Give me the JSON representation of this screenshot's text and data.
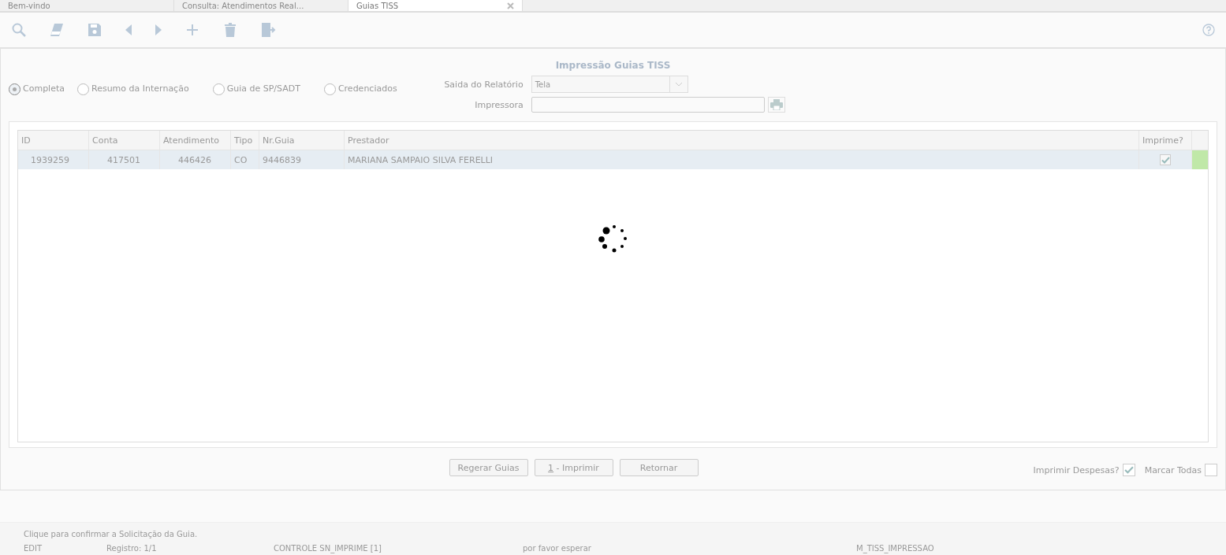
{
  "tabs": [
    {
      "label": "Bem-vindo",
      "selected": false,
      "closable": false
    },
    {
      "label": "Consulta: Atendimentos Real...",
      "selected": false,
      "closable": false
    },
    {
      "label": "Guias TISS",
      "selected": true,
      "closable": true
    }
  ],
  "toolbar": [
    {
      "kind": "search"
    },
    {
      "kind": "eraser"
    },
    {
      "kind": "save"
    },
    {
      "kind": "prev"
    },
    {
      "kind": "next"
    },
    {
      "kind": "add"
    },
    {
      "kind": "delete"
    },
    {
      "kind": "exit"
    }
  ],
  "title": "Impressão Guias TISS",
  "report_types": [
    {
      "label": "Completa",
      "selected": true
    },
    {
      "label": "Resumo da Internação",
      "selected": false
    },
    {
      "label": "Guia de SP/SADT",
      "selected": false
    },
    {
      "label": "Credenciados",
      "selected": false
    }
  ],
  "output": {
    "label": "Saida do Relatório",
    "value": "Tela"
  },
  "printer": {
    "label": "Impressora"
  },
  "table": {
    "columns": [
      "ID",
      "Conta",
      "Atendimento",
      "Tipo",
      "Nr.Guia",
      "Prestador",
      "Imprime?"
    ],
    "rows": [
      {
        "id": "1939259",
        "conta": "417501",
        "atendimento": "446426",
        "tipo": "CO",
        "nr_guia": "9446839",
        "prestador": "MARIANA SAMPAIO SILVA FERELLI",
        "imprime": true,
        "selected": true,
        "color": "#c0e8a8"
      }
    ]
  },
  "loading": true,
  "buttons": [
    {
      "label": "Regerar Guias"
    },
    {
      "shortcut": "1",
      "label": " - Imprimir"
    },
    {
      "label": "Retornar"
    }
  ],
  "options": [
    {
      "label": "Imprimir Despesas?",
      "checked": true
    },
    {
      "label": "Marcar Todas",
      "checked": false
    }
  ],
  "hint": "Clique para confirmar a Solicitação da Guia.",
  "status_bar": [
    "EDIT",
    "Registro: 1/1",
    "CONTROLE SN_IMPRIME [1]",
    "por favor esperar",
    "M_TISS_IMPRESSAO"
  ]
}
